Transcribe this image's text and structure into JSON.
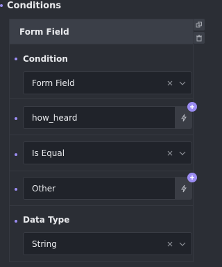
{
  "section": {
    "title": "Conditions"
  },
  "panel": {
    "header_title": "Form Field",
    "duplicate_icon": "duplicate-icon",
    "delete_icon": "trash-icon"
  },
  "condition": {
    "label": "Condition",
    "value": "Form Field",
    "clear_icon": "close-icon",
    "dropdown_icon": "chevron-down-icon"
  },
  "field_name": {
    "value": "how_heard",
    "dynamic_icon": "lightning-icon",
    "add_icon": "plus-icon"
  },
  "operator": {
    "value": "Is Equal",
    "clear_icon": "close-icon",
    "dropdown_icon": "chevron-down-icon"
  },
  "compare_value": {
    "value": "Other",
    "dynamic_icon": "lightning-icon",
    "add_icon": "plus-icon"
  },
  "data_type": {
    "label": "Data Type",
    "value": "String",
    "clear_icon": "close-icon",
    "dropdown_icon": "chevron-down-icon"
  },
  "colors": {
    "background": "#2b2e35",
    "accent": "#9b8cf2",
    "field_bg": "#20232a",
    "header_bg": "#3b3f48"
  }
}
